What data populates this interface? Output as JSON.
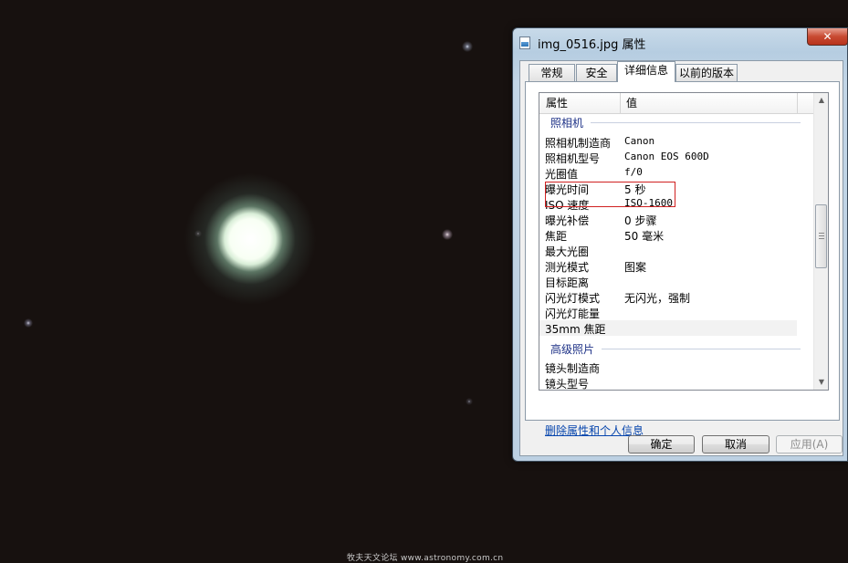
{
  "window": {
    "title": "img_0516.jpg 属性",
    "close_label": "✕"
  },
  "tabs": [
    {
      "label": "常规"
    },
    {
      "label": "安全"
    },
    {
      "label": "详细信息",
      "active": true
    },
    {
      "label": "以前的版本"
    }
  ],
  "details": {
    "columns": {
      "property": "属性",
      "value": "值"
    },
    "group_camera": "照相机",
    "rows": [
      {
        "name": "照相机制造商",
        "value": "Canon"
      },
      {
        "name": "照相机型号",
        "value": "Canon EOS 600D"
      },
      {
        "name": "光圈值",
        "value": "f/0"
      },
      {
        "name": "曝光时间",
        "value": "5 秒"
      },
      {
        "name": "ISO 速度",
        "value": "ISO-1600"
      },
      {
        "name": "曝光补偿",
        "value": "0 步骤"
      },
      {
        "name": "焦距",
        "value": "50 毫米"
      },
      {
        "name": "最大光圈",
        "value": ""
      },
      {
        "name": "测光模式",
        "value": "图案"
      },
      {
        "name": "目标距离",
        "value": ""
      },
      {
        "name": "闪光灯模式",
        "value": "无闪光，强制"
      },
      {
        "name": "闪光灯能量",
        "value": ""
      },
      {
        "name": "35mm 焦距",
        "value": ""
      }
    ],
    "group_advanced": "高级照片",
    "advanced_rows": [
      {
        "name": "镜头制造商",
        "value": ""
      },
      {
        "name": "镜头型号",
        "value": ""
      }
    ]
  },
  "remove_link": "删除属性和个人信息",
  "buttons": {
    "ok": "确定",
    "cancel": "取消",
    "apply": "应用(A)"
  },
  "watermark": "牧夫天文论坛 www.astronomy.com.cn"
}
